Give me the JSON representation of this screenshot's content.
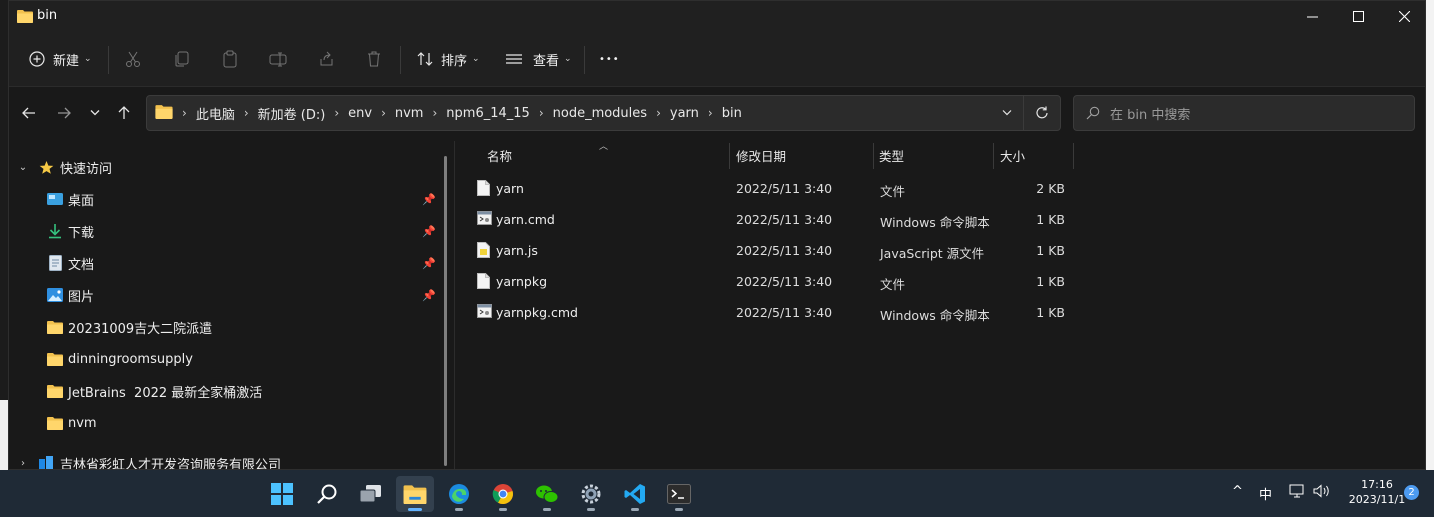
{
  "window": {
    "title": "bin"
  },
  "toolbar": {
    "new_label": "新建",
    "sort_label": "排序",
    "view_label": "查看",
    "more_label": "•••"
  },
  "address": {
    "crumbs": [
      "此电脑",
      "新加卷 (D:)",
      "env",
      "nvm",
      "npm6_14_15",
      "node_modules",
      "yarn",
      "bin"
    ]
  },
  "search": {
    "placeholder": "在 bin 中搜索"
  },
  "nav": {
    "quick_access": "快速访问",
    "pinned": [
      {
        "label": "桌面",
        "icon": "desktop-icon"
      },
      {
        "label": "下载",
        "icon": "download-icon"
      },
      {
        "label": "文档",
        "icon": "document-icon"
      },
      {
        "label": "图片",
        "icon": "pictures-icon"
      }
    ],
    "folders": [
      "20231009吉大二院派遣",
      "dinningroomsupply",
      "JetBrains  2022 最新全家桶激活",
      "nvm"
    ],
    "org": "吉林省彩虹人才开发咨询服务有限公司"
  },
  "columns": {
    "name": "名称",
    "date": "修改日期",
    "type": "类型",
    "size": "大小"
  },
  "files": [
    {
      "name": "yarn",
      "date": "2022/5/11 3:40",
      "type": "文件",
      "size": "2 KB",
      "icon": "file-icon"
    },
    {
      "name": "yarn.cmd",
      "date": "2022/5/11 3:40",
      "type": "Windows 命令脚本",
      "size": "1 KB",
      "icon": "cmd-file-icon"
    },
    {
      "name": "yarn.js",
      "date": "2022/5/11 3:40",
      "type": "JavaScript 源文件",
      "size": "1 KB",
      "icon": "js-file-icon"
    },
    {
      "name": "yarnpkg",
      "date": "2022/5/11 3:40",
      "type": "文件",
      "size": "1 KB",
      "icon": "file-icon"
    },
    {
      "name": "yarnpkg.cmd",
      "date": "2022/5/11 3:40",
      "type": "Windows 命令脚本",
      "size": "1 KB",
      "icon": "cmd-file-icon"
    }
  ],
  "taskbar": {
    "ime": "中",
    "time": "17:16",
    "date": "2023/11/1",
    "notifications": "2"
  },
  "colors": {
    "folder": "#f2c14e",
    "accent": "#4d9bf0",
    "taskbar": "#1f2a36"
  }
}
